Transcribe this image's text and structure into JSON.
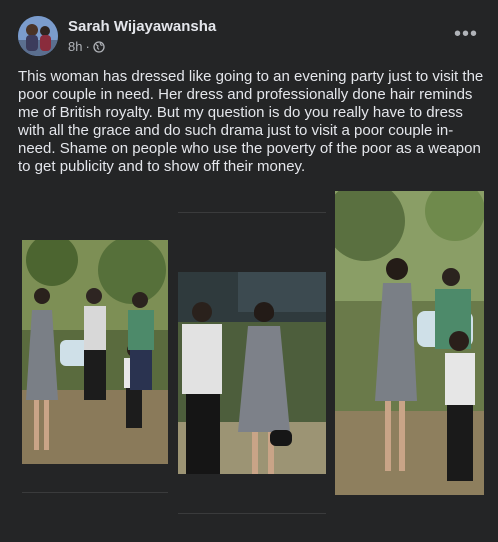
{
  "post": {
    "author": "Sarah Wijayawansha",
    "time": "8h",
    "dot": "·",
    "more_label": "•••",
    "text": "This woman has dressed like going to an evening party just to visit the poor couple in need. Her dress and professionally done hair reminds me of British royalty. But my question is do you really have to dress with all the grace and do such drama just to visit a poor couple in-need. Shame on people who use the poverty of the poor as a weapon to get publicity and to show off their money."
  },
  "icons": {
    "privacy": "globe-icon",
    "more": "more-options-icon"
  },
  "colors": {
    "background": "#242526",
    "text": "#e4e6eb",
    "muted": "#b0b3b8"
  }
}
